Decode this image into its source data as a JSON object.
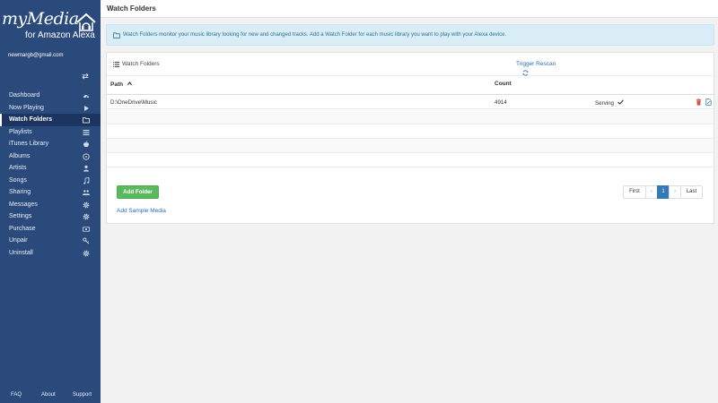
{
  "sidebar": {
    "brand": "myMedia",
    "brand_sub": "for Amazon Alexa",
    "email": "newmargb@gmail.com",
    "items": [
      {
        "label": "Dashboard",
        "icon": "tachometer-icon"
      },
      {
        "label": "Now Playing",
        "icon": "play-icon"
      },
      {
        "label": "Watch Folders",
        "icon": "folder-icon",
        "active": true
      },
      {
        "label": "Playlists",
        "icon": "list-icon"
      },
      {
        "label": "iTunes Library",
        "icon": "apple-icon"
      },
      {
        "label": "Albums",
        "icon": "disc-icon"
      },
      {
        "label": "Artists",
        "icon": "user-icon"
      },
      {
        "label": "Songs",
        "icon": "music-note-icon"
      },
      {
        "label": "Sharing",
        "icon": "users-icon"
      },
      {
        "label": "Messages",
        "icon": "gear-icon"
      },
      {
        "label": "Settings",
        "icon": "gear-icon"
      },
      {
        "label": "Purchase",
        "icon": "money-icon"
      },
      {
        "label": "Unpair",
        "icon": "key-icon"
      },
      {
        "label": "Uninstall",
        "icon": "gear-icon"
      }
    ],
    "footer": {
      "faq": "FAQ",
      "about": "About",
      "support": "Support"
    }
  },
  "topbar": {
    "title": "Watch Folders"
  },
  "alert": {
    "text": "Watch Folders monitor your music library looking for new and changed tracks. Add a Watch Folder for each music library you want to play with your Alexa device."
  },
  "panel": {
    "title": "Watch Folders",
    "rescan_label": "Trigger Rescan",
    "columns": {
      "path": "Path",
      "count": "Count"
    },
    "rows": [
      {
        "path": "D:\\OneDrive\\Music",
        "count": "4914",
        "status": "Serving"
      }
    ],
    "add_folder_label": "Add Folder",
    "add_sample_label": "Add Sample Media",
    "pager": {
      "first": "First",
      "prev": "‹",
      "page": "1",
      "next": "›",
      "last": "Last"
    }
  },
  "colors": {
    "sidebar": "#2b4a7c",
    "sidebar_active": "#1c3460",
    "alert_bg": "#d9edf7",
    "alert_text": "#31708f",
    "success": "#5cb85c",
    "link": "#2a6ebb",
    "primary": "#337ab7",
    "danger": "#d9534f"
  }
}
